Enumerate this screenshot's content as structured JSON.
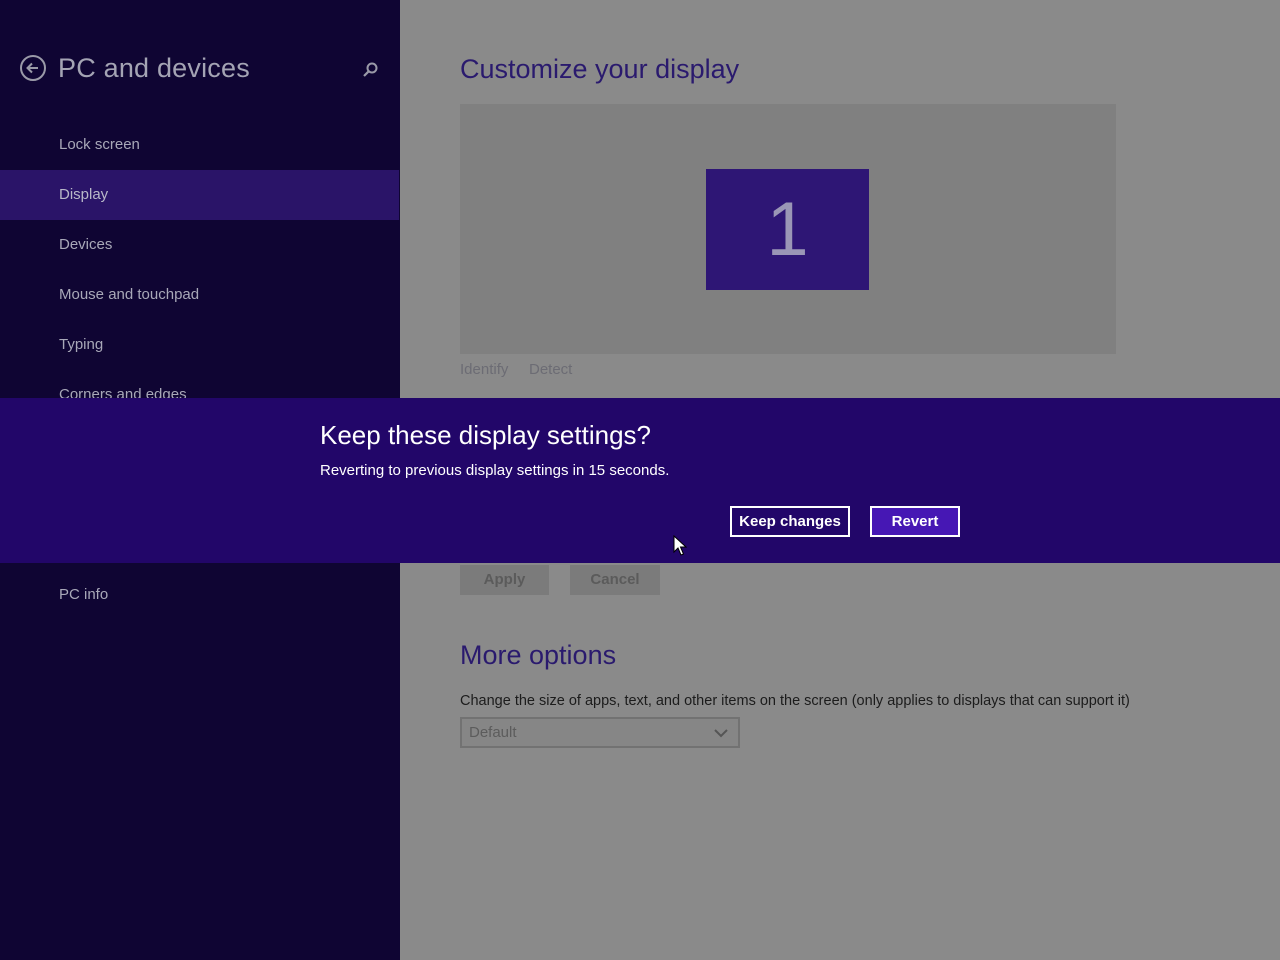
{
  "colors": {
    "accent": "#220669",
    "sidebar_bg": "#0f0533",
    "selected_nav": "#2a1468",
    "revert_button": "#4617b4"
  },
  "sidebar": {
    "back_icon": "back-arrow-icon",
    "title": "PC and devices",
    "search_icon": "search-icon",
    "items": [
      {
        "label": "Lock screen",
        "selected": false
      },
      {
        "label": "Display",
        "selected": true
      },
      {
        "label": "Devices",
        "selected": false
      },
      {
        "label": "Mouse and touchpad",
        "selected": false
      },
      {
        "label": "Typing",
        "selected": false
      },
      {
        "label": "Corners and edges",
        "selected": false
      },
      {
        "label": "PC info",
        "selected": false
      }
    ]
  },
  "main": {
    "title": "Customize your display",
    "monitor_number": "1",
    "identify_label": "Identify",
    "detect_label": "Detect",
    "apply_label": "Apply",
    "cancel_label": "Cancel",
    "more_options_title": "More options",
    "size_description": "Change the size of apps, text, and other items on the screen (only applies to displays that can support it)",
    "size_select_value": "Default"
  },
  "dialog": {
    "title": "Keep these display settings?",
    "message": "Reverting to previous display settings in 15 seconds.",
    "keep_label": "Keep changes",
    "revert_label": "Revert"
  }
}
